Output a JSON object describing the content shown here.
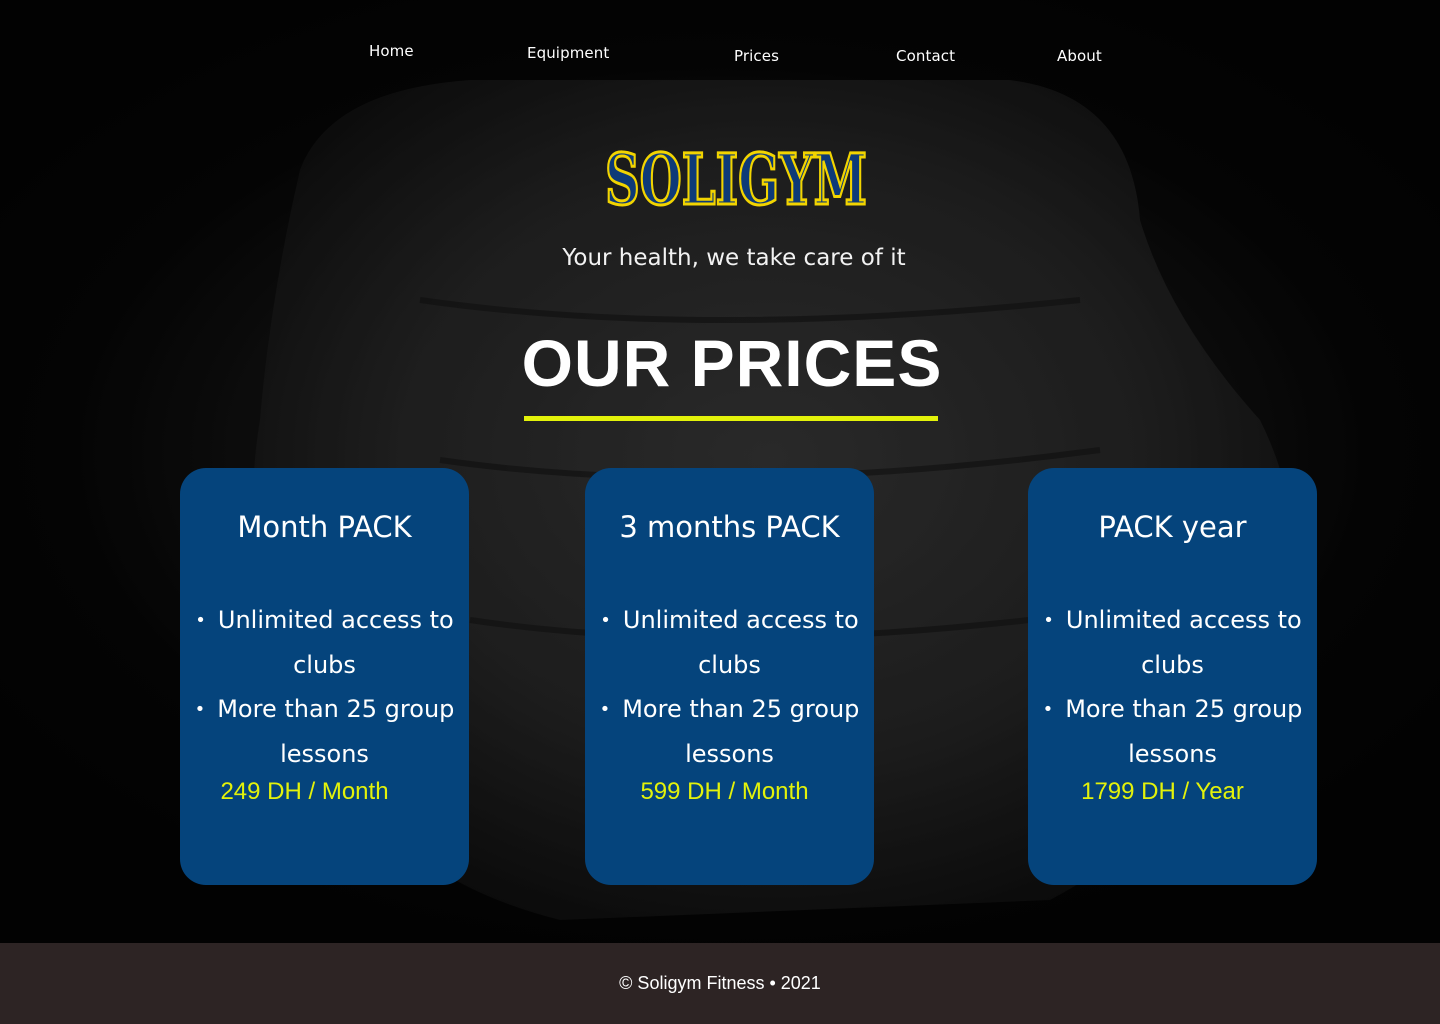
{
  "nav": {
    "items": [
      {
        "label": "Home"
      },
      {
        "label": "Equipment"
      },
      {
        "label": "Prices"
      },
      {
        "label": "Contact"
      },
      {
        "label": "About"
      }
    ]
  },
  "hero": {
    "logo_text": "SOLIGYM",
    "tagline": "Your health, we take care of it",
    "title": "OUR PRICES"
  },
  "cards": [
    {
      "title": "Month PACK",
      "features": [
        "Unlimited access to clubs",
        "More than 25 group lessons"
      ],
      "price": "249 DH / Month"
    },
    {
      "title": "3 months PACK",
      "features": [
        "Unlimited access to clubs",
        "More than 25 group lessons"
      ],
      "price": "599 DH / Month"
    },
    {
      "title": "PACK year",
      "features": [
        "Unlimited access to clubs",
        "More than 25 group lessons"
      ],
      "price": "1799 DH / Year"
    }
  ],
  "footer": {
    "text": "© Soligym Fitness • 2021"
  },
  "colors": {
    "card_bg": "#05447c",
    "accent": "#e3f20a",
    "logo_fill": "#0d3a78",
    "logo_outline": "#f2d400",
    "footer_bg": "#2d2424"
  }
}
